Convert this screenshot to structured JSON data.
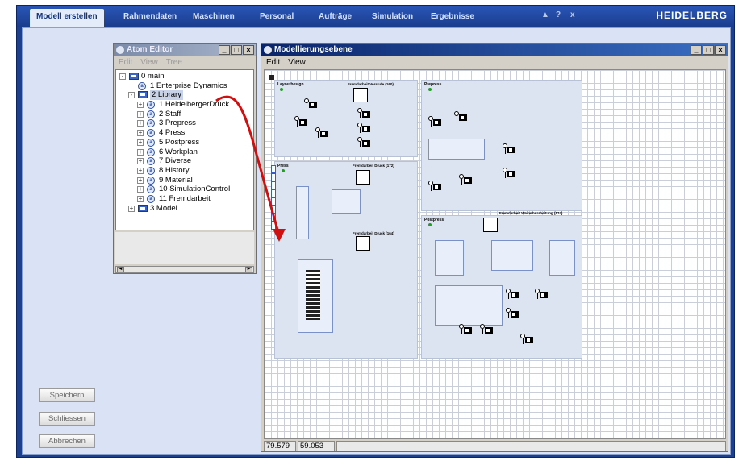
{
  "tabs": [
    "Modell erstellen",
    "Rahmendaten",
    "Maschinen",
    "Personal",
    "Aufträge",
    "Simulation",
    "Ergebnisse"
  ],
  "window_controls": [
    "▲",
    "?",
    "x"
  ],
  "brand": "HEIDELBERG",
  "side_buttons": {
    "save": "Speichern",
    "close": "Schliessen",
    "cancel": "Abbrechen"
  },
  "atom_editor": {
    "title": "Atom Editor",
    "menu": [
      "Edit",
      "View",
      "Tree"
    ],
    "tree": [
      {
        "label": "0 main",
        "level": 0,
        "type": "folder",
        "expander": "-"
      },
      {
        "label": "1 Enterprise Dynamics",
        "level": 1,
        "type": "atom",
        "expander": ""
      },
      {
        "label": "2 Library",
        "level": 1,
        "type": "folder",
        "expander": "-",
        "selected": true
      },
      {
        "label": "1 HeidelbergerDruck",
        "level": 2,
        "type": "atom",
        "expander": "+"
      },
      {
        "label": "2 Staff",
        "level": 2,
        "type": "atom",
        "expander": "+"
      },
      {
        "label": "3 Prepress",
        "level": 2,
        "type": "atom",
        "expander": "+"
      },
      {
        "label": "4 Press",
        "level": 2,
        "type": "atom",
        "expander": "+"
      },
      {
        "label": "5 Postpress",
        "level": 2,
        "type": "atom",
        "expander": "+"
      },
      {
        "label": "6 Workplan",
        "level": 2,
        "type": "atom",
        "expander": "+"
      },
      {
        "label": "7 Diverse",
        "level": 2,
        "type": "atom",
        "expander": "+"
      },
      {
        "label": "8 History",
        "level": 2,
        "type": "atom",
        "expander": "+"
      },
      {
        "label": "9 Material",
        "level": 2,
        "type": "atom",
        "expander": "+"
      },
      {
        "label": "10 SimulationControl",
        "level": 2,
        "type": "atom",
        "expander": "+"
      },
      {
        "label": "11 Fremdarbeit",
        "level": 2,
        "type": "atom",
        "expander": "+"
      },
      {
        "label": "3 Model",
        "level": 1,
        "type": "folder",
        "expander": "+"
      }
    ]
  },
  "model_window": {
    "title": "Modellierungsebene",
    "menu": [
      "Edit",
      "View"
    ],
    "status": [
      "79.579",
      "59.053"
    ],
    "zones": {
      "layout": "Layoutbesign",
      "fremd_vorstufe": "Fremdarbeit Vorstufe (160)",
      "prepress": "Prepress",
      "press": "Press",
      "fremd_druck1": "Fremdarbeit Druck (172)",
      "fremd_druck2": "Fremdarbeit Druck (164)",
      "fremd_weiter": "Fremdarbeit Weiterbearbeitung (174)",
      "postpress": "Postpress"
    }
  }
}
